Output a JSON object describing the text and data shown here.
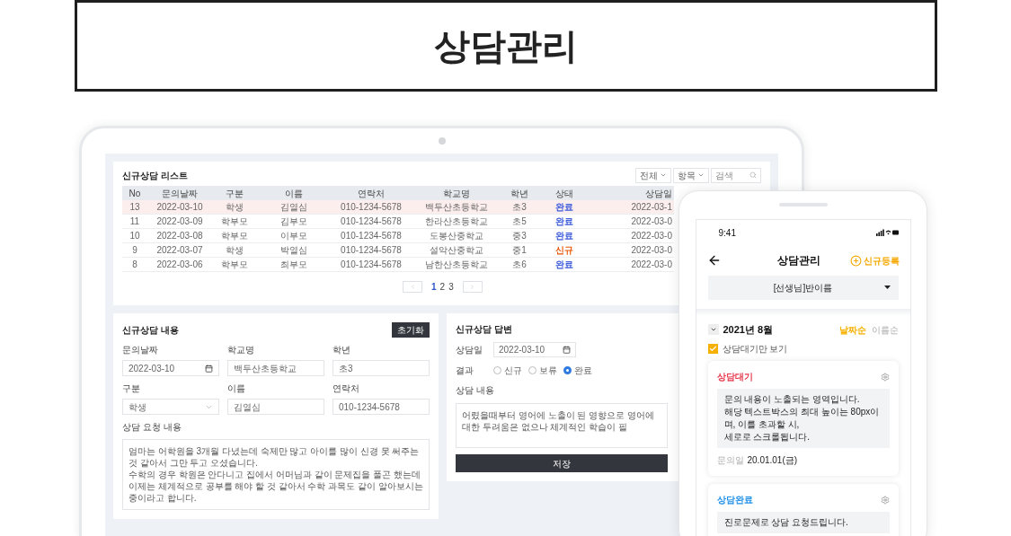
{
  "page_title": "상담관리",
  "laptop": {
    "list": {
      "title": "신규상담 리스트",
      "filters": [
        {
          "kind": "select",
          "label": "전체"
        },
        {
          "kind": "select",
          "label": "항목"
        },
        {
          "kind": "search",
          "placeholder": "검색"
        }
      ],
      "columns": [
        "No",
        "문의날짜",
        "구분",
        "이름",
        "연락처",
        "학교명",
        "학년",
        "상태",
        "상담일"
      ],
      "rows": [
        {
          "selected": true,
          "color": "#3b5bdb",
          "cells": [
            "13",
            "2022-03-10",
            "학생",
            "김열심",
            "010-1234-5678",
            "백두산초등학교",
            "초3",
            "완료",
            "2022-03-1"
          ]
        },
        {
          "selected": false,
          "color": "#3b5bdb",
          "cells": [
            "11",
            "2022-03-09",
            "학부모",
            "김부모",
            "010-1234-5678",
            "한라산초등학교",
            "초5",
            "완료",
            "2022-03-0"
          ]
        },
        {
          "selected": false,
          "color": "#3b5bdb",
          "cells": [
            "10",
            "2022-03-08",
            "학부모",
            "이부모",
            "010-1234-5678",
            "도봉산중학교",
            "중3",
            "완료",
            "2022-03-0"
          ]
        },
        {
          "selected": false,
          "color": "#e8590c",
          "cells": [
            "9",
            "2022-03-07",
            "학생",
            "박열심",
            "010-1234-5678",
            "설악산중학교",
            "중1",
            "신규",
            "2022-03-0"
          ]
        },
        {
          "selected": false,
          "color": "#3b5bdb",
          "cells": [
            "8",
            "2022-03-06",
            "학부모",
            "최부모",
            "010-1234-5678",
            "남한산초등학교",
            "초6",
            "완료",
            "2022-03-0"
          ]
        }
      ],
      "pages": [
        {
          "label": "1",
          "selected": true
        },
        {
          "label": "2",
          "selected": false
        },
        {
          "label": "3",
          "selected": false
        }
      ]
    },
    "inquiry": {
      "title": "신규상담 내용",
      "reset_button": "초기화",
      "fields": [
        {
          "kind": "date",
          "label": "문의날짜",
          "value": "2022-03-10"
        },
        {
          "kind": "text",
          "label": "학교명",
          "value": "백두산초등학교"
        },
        {
          "kind": "text",
          "label": "학년",
          "value": "초3"
        },
        {
          "kind": "select",
          "label": "구분",
          "value": "학생"
        },
        {
          "kind": "text",
          "label": "이름",
          "value": "김열심"
        },
        {
          "kind": "text",
          "label": "연락처",
          "value": "010-1234-5678"
        }
      ],
      "request_label": "상담 요청 내용",
      "request_lines": [
        "엄마는 어학원을 3개월 다녔는데 숙제만 많고 아이를 많이 신경 못 써주는것 같아서 그만 두고 오셨습니다.",
        "수학의 경우 학원은 안다니고 집에서 어머님과 같이 문제집을 풀곤 했는데",
        "이제는 체계적으로 공부를 해야 할 것 같아서 수학 과목도 같이 알아보시는 중이라고 합니다."
      ]
    },
    "answer": {
      "title": "신규상담 답변",
      "date_label": "상담일",
      "date_value": "2022-03-10",
      "result_label": "결과",
      "options": [
        {
          "label": "신규",
          "selected": false
        },
        {
          "label": "보류",
          "selected": false
        },
        {
          "label": "완료",
          "selected": true
        }
      ],
      "content_label": "상담 내용",
      "content": "어렸을때부터 영어에 노출이 된 영향으로 영어에 대한 두려움은 없으나 체계적인 학습이 필",
      "save_button": "저장"
    }
  },
  "phone": {
    "time": "9:41",
    "title": "상담관리",
    "add_button": "신규등록",
    "class_select": "[선생님]반이름",
    "month": "2021년 8월",
    "sorts": [
      {
        "label": "날짜순",
        "selected": true
      },
      {
        "label": "이름순",
        "selected": false
      }
    ],
    "waiting_only": {
      "label": "상담대기만 보기",
      "checked": true
    },
    "cards": [
      {
        "status": "상담대기",
        "color": "#e8364a",
        "content": [
          "문의 내용이 노출되는 영역입니다.",
          "해당 텍스트박스의 최대 높이는 80px이며, 이를 초과할 시,",
          "세로로 스크롤됩니다."
        ],
        "date_label": "문의일",
        "date": "20.01.01(금)"
      },
      {
        "status": "상담완료",
        "color": "#1e8fe8",
        "content": [
          "진로문제로 상담 요청드립니다."
        ]
      }
    ]
  }
}
